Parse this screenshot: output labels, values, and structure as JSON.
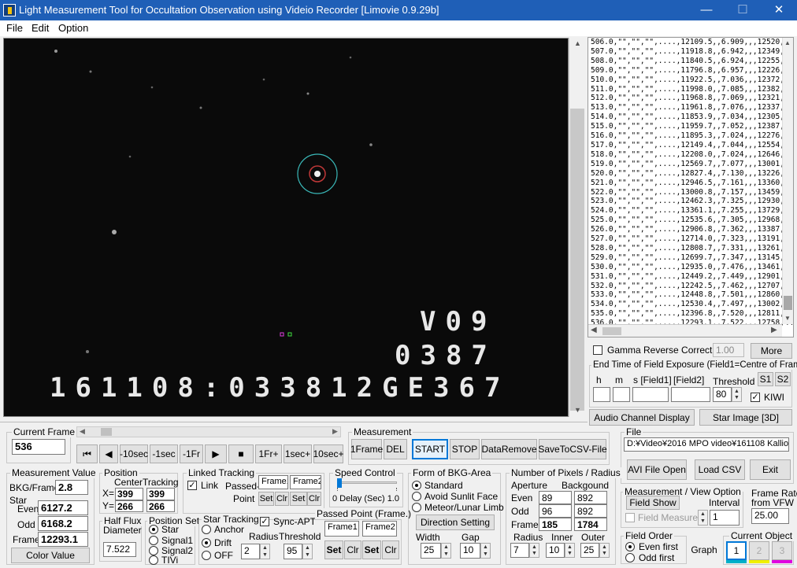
{
  "window": {
    "title": "Light Measurement Tool for Occultation Observation using Videio Recorder [Limovie 0.9.29b]",
    "minimize": "—",
    "maximize": "☐",
    "close": "✕"
  },
  "menu": [
    "File",
    "Edit",
    "Option"
  ],
  "osd": {
    "line1": "V09",
    "line2": "0387",
    "line3": "161108:033812GE367"
  },
  "log": [
    "506.0,\"\",\"\",\"\",....,12109.5,,6.909,,,12520,3959,185,178",
    "507.0,\"\",\"\",\"\",....,11918.8,,6.942,,,12349,4149,185,178",
    "508.0,\"\",\"\",\"\",....,11840.5,,6.924,,,12255,3997,185,178",
    "509.0,\"\",\"\",\"\",....,11796.8,,6.957,,,12226,4139,185,178",
    "510.0,\"\",\"\",\"\",....,11922.5,,7.036,,,12372,4335,185,178",
    "511.0,\"\",\"\",\"\",....,11998.0,,7.085,,,12382,3703,185,178",
    "512.0,\"\",\"\",\"\",....,11968.8,,7.069,,,12321,3396,185,178",
    "513.0,\"\",\"\",\"\",....,11961.8,,7.076,,,12337,3618,185,178",
    "514.0,\"\",\"\",\"\",....,11853.9,,7.034,,,12305,4350,185,178",
    "515.0,\"\",\"\",\"\",....,11959.7,,7.052,,,12387,4121,185,178",
    "516.0,\"\",\"\",\"\",....,11895.3,,7.024,,,12276,3671,185,178",
    "517.0,\"\",\"\",\"\",....,12149.4,,7.044,,,12554,3902,185,178",
    "518.0,\"\",\"\",\"\",....,12208.0,,7.024,,,12646,4224,185,178",
    "519.0,\"\",\"\",\"\",....,12569.7,,7.077,,,13001,4159,185,178",
    "520.0,\"\",\"\",\"\",....,12827.4,,7.130,,,13226,3844,185,178",
    "521.0,\"\",\"\",\"\",....,12946.5,,7.161,,,13360,3987,185,178",
    "522.0,\"\",\"\",\"\",....,13000.8,,7.157,,,13459,4419,185,178",
    "523.0,\"\",\"\",\"\",....,12462.3,,7.325,,,12930,4510,185,178",
    "524.0,\"\",\"\",\"\",....,13361.1,,7.255,,,13729,4512,185,178",
    "525.0,\"\",\"\",\"\",....,12535.6,,7.305,,,12968,4170,185,178",
    "526.0,\"\",\"\",\"\",....,12906.8,,7.362,,,13387,4631,185,178",
    "527.0,\"\",\"\",\"\",....,12714.0,,7.323,,,13191,4600,185,178",
    "528.0,\"\",\"\",\"\",....,12808.7,,7.331,,,13261,4362,185,178",
    "529.0,\"\",\"\",\"\",....,12699.7,,7.347,,,13145,4294,185,178",
    "530.0,\"\",\"\",\"\",....,12935.0,,7.476,,,13461,5072,185,178",
    "531.0,\"\",\"\",\"\",....,12449.2,,7.449,,,12901,4357,185,178",
    "532.0,\"\",\"\",\"\",....,12242.5,,7.462,,,12707,4479,185,178",
    "533.0,\"\",\"\",\"\",....,12448.8,,7.501,,,12860,3965,185,178",
    "534.0,\"\",\"\",\"\",....,12530.4,,7.497,,,13002,4548,185,178",
    "535.0,\"\",\"\",\"\",....,12396.8,,7.520,,,12811,3994,185,178",
    "536.0,\"\",\"\",\"\",....,12293.1,,7.522,,,12758,4483,185,178"
  ],
  "gamma": {
    "label": "Gamma Reverse Correction",
    "value": "1.00",
    "more": "More"
  },
  "endtime": {
    "title": "End Time of Field Exposure (Field1=Centre of Frame)",
    "h": "h",
    "m": "m",
    "s": "s [Field1]",
    "f2": "[Field2]",
    "threshold_label": "Threshold",
    "threshold": "80",
    "s1": "S1",
    "s2": "S2",
    "kiwi": "KIWI"
  },
  "audio_btn": "Audio Channel Display",
  "starimage_btn": "Star Image [3D]",
  "current_frame": {
    "label": "Current Frame",
    "value": "536"
  },
  "nav": {
    "first": "⏮",
    "back": "◀",
    "m10sec": "-10sec",
    "m1sec": "-1sec",
    "m1fr": "-1Fr",
    "play": "▶",
    "stop": "■",
    "p1fr": "1Fr+",
    "p1sec": "1sec+",
    "p10sec": "10sec+"
  },
  "measurement": {
    "title": "Measurement",
    "oneframe": "1Frame",
    "del": "DEL",
    "start": "START",
    "stop": "STOP",
    "dataremove": "DataRemove",
    "savecsv": "SaveToCSV-File"
  },
  "file": {
    "title": "File",
    "path": "D:¥Video¥2016 MPO video¥161108 Kalliope",
    "avi": "AVI File Open",
    "load": "Load CSV",
    "exit": "Exit"
  },
  "mvalue": {
    "title": "Measurement Value",
    "bkg_label": "BKG/Frame",
    "bkg": "2.8",
    "star": "Star",
    "even_label": "Even",
    "even": "6127.2",
    "odd_label": "Odd",
    "odd": "6168.2",
    "frame_label": "Frame",
    "frame": "12293.1",
    "color": "Color Value"
  },
  "position": {
    "title": "Position",
    "center": "Center",
    "tracking": "Tracking",
    "x_label": "X=",
    "y_label": "Y=",
    "cx": "399",
    "cy": "266",
    "tx": "399",
    "ty": "266"
  },
  "linked": {
    "title": "Linked Tracking",
    "link": "Link",
    "passed": "Passed-",
    "point": "Point",
    "frame1": "Frame1",
    "frame2": "Frame2",
    "set": "Set",
    "clr": "Clr"
  },
  "speed": {
    "title": "Speed Control",
    "delay": "0  Delay (Sec) 1.0"
  },
  "halfflux": {
    "title": "Half Flux",
    "diameter": "Diameter",
    "value": "7.522"
  },
  "posset": {
    "title": "Position Set",
    "star": "Star",
    "signal1": "Signal1",
    "signal2": "Signal2",
    "tivi": "TIVi"
  },
  "startrack": {
    "title": "Star Tracking",
    "anchor": "Anchor",
    "drift": "Drift",
    "off": "OFF",
    "sync": "Sync-APT",
    "radius_label": "Radius",
    "threshold_label": "Threshold",
    "radius": "2",
    "threshold": "95"
  },
  "passed": {
    "title": "Passed Point (Frame.)",
    "frame1": "Frame1",
    "frame2": "Frame2",
    "set": "Set",
    "clr": "Clr"
  },
  "bkg": {
    "title": "Form of BKG-Area",
    "standard": "Standard",
    "avoid": "Avoid Sunlit Face",
    "meteor": "Meteor/Lunar Limb",
    "direction": "Direction Setting",
    "width_label": "Width",
    "gap_label": "Gap",
    "width": "25",
    "gap": "10"
  },
  "pixels": {
    "title": "Number of Pixels / Radius",
    "aperture": "Aperture",
    "background": "Backgound",
    "even_label": "Even",
    "odd_label": "Odd",
    "frame_label": "Frame",
    "even_ap": "89",
    "even_bg": "892",
    "odd_ap": "96",
    "odd_bg": "892",
    "frame_ap": "185",
    "frame_bg": "1784",
    "radius_label": "Radius",
    "inner_label": "Inner",
    "outer_label": "Outer",
    "radius": "7",
    "inner": "10",
    "outer": "25"
  },
  "mview": {
    "title": "Measurement / View Option",
    "fieldshow": "Field Show",
    "fieldmeasure": "Field Measure",
    "interval_label": "Interval",
    "interval": "1"
  },
  "framerate": {
    "title": "Frame Rate",
    "from": "from VFW",
    "value": "25.00"
  },
  "fieldorder": {
    "title": "Field Order",
    "even": "Even first",
    "odd": "Odd first"
  },
  "graph": "Graph",
  "curobj": {
    "title": "Current Object",
    "o1": "1",
    "o2": "2",
    "o3": "3"
  }
}
